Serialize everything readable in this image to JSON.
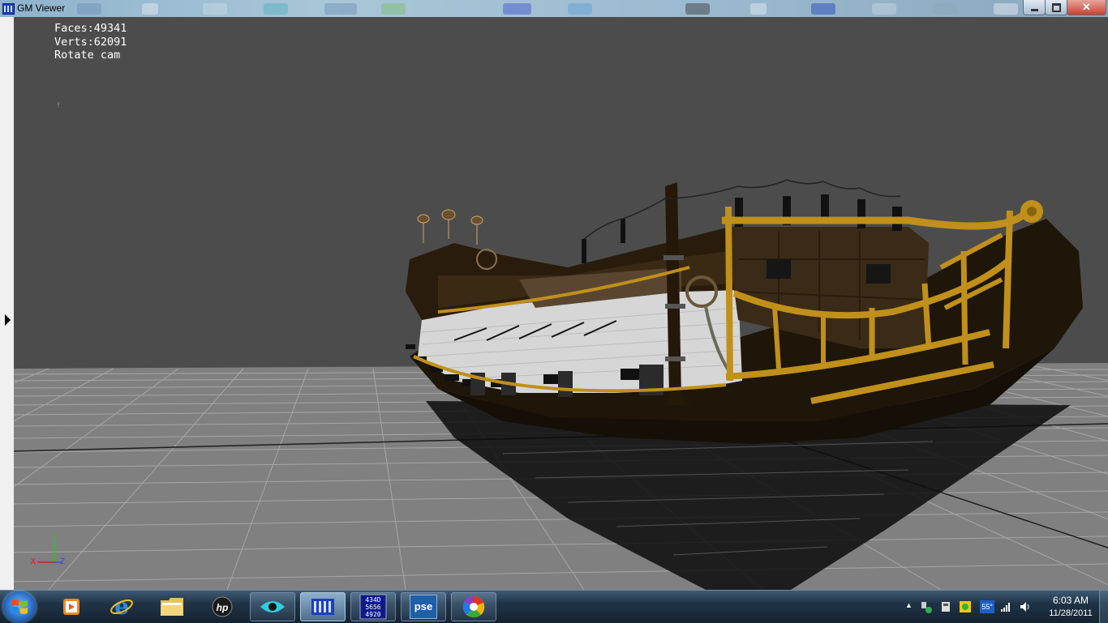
{
  "window": {
    "title": "GM Viewer",
    "controls": {
      "minimize": "minimize-icon",
      "maximize": "maximize-icon",
      "close": "close-icon"
    }
  },
  "viewport": {
    "stats": {
      "faces": "Faces:49341",
      "verts": "Verts:62091",
      "mode": "Rotate cam"
    },
    "marker": "!",
    "axes": {
      "y": "Y",
      "x": "X",
      "z": "Z"
    },
    "colors": {
      "background": "#4c4c4c",
      "grid": "#a0a0a0",
      "floor": "#808080",
      "hull": "#1e1409",
      "trim": "#c29216",
      "planks": "#d7d7d7"
    }
  },
  "taskbar": {
    "start_icon": "windows-orb-icon",
    "items": [
      {
        "name": "media-player",
        "icon": "media-player-icon",
        "state": "pinned"
      },
      {
        "name": "internet-explorer",
        "icon": "internet-explorer-icon",
        "state": "pinned"
      },
      {
        "name": "file-explorer",
        "icon": "folder-icon",
        "state": "pinned"
      },
      {
        "name": "hp",
        "icon": "hp-icon",
        "state": "pinned"
      },
      {
        "name": "eye-app",
        "icon": "eye-icon",
        "state": "open"
      },
      {
        "name": "gm-viewer",
        "icon": "gm-viewer-icon",
        "state": "active"
      },
      {
        "name": "calculator",
        "icon": "calculator-icon",
        "state": "open",
        "text": "434D 5656 4920"
      },
      {
        "name": "photoshop-elements",
        "icon": "pse-icon",
        "state": "open",
        "text": "pse"
      },
      {
        "name": "picasa",
        "icon": "picasa-icon",
        "state": "open"
      }
    ],
    "tray": {
      "temperature": "55°",
      "time": "6:03 AM",
      "date": "11/28/2011"
    }
  }
}
